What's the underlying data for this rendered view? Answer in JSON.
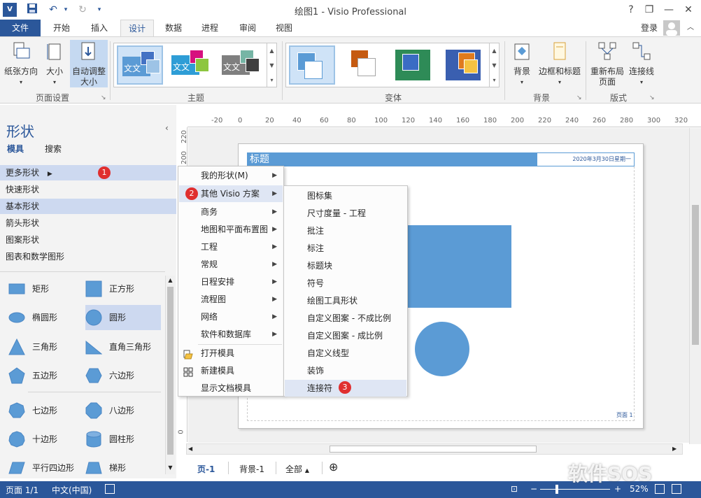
{
  "window": {
    "title": "绘图1 - Visio Professional",
    "help": "?",
    "minimize": "—",
    "restore": "❐",
    "close": "✕"
  },
  "tabs": [
    {
      "label": "文件"
    },
    {
      "label": "开始"
    },
    {
      "label": "插入"
    },
    {
      "label": "设计"
    },
    {
      "label": "数据"
    },
    {
      "label": "进程"
    },
    {
      "label": "审阅"
    },
    {
      "label": "视图"
    }
  ],
  "account": {
    "signin": "登录"
  },
  "ribbon": {
    "orientation": "纸张方向",
    "size": "大小",
    "autofit_l1": "自动调整",
    "autofit_l2": "大小",
    "page_setup": "页面设置",
    "themes": "主题",
    "variants": "变体",
    "theme_text": "文文",
    "background": "背景",
    "borders": "边框和标题",
    "bg_group": "背景",
    "relayout_l1": "重新布局",
    "relayout_l2": "页面",
    "connectors": "连接线",
    "layout_group": "版式"
  },
  "shapes_panel": {
    "title": "形状",
    "tab_stencils": "模具",
    "tab_search": "搜索",
    "categories": [
      "更多形状",
      "快速形状",
      "基本形状",
      "箭头形状",
      "图案形状",
      "图表和数学图形"
    ],
    "items": [
      "矩形",
      "正方形",
      "椭圆形",
      "圆形",
      "三角形",
      "直角三角形",
      "五边形",
      "六边形",
      "七边形",
      "八边形",
      "十边形",
      "圆柱形",
      "平行四边形",
      "梯形"
    ]
  },
  "menu1": {
    "items": [
      "我的形状(M)",
      "其他 Visio 方案",
      "商务",
      "地图和平面布置图",
      "工程",
      "常规",
      "日程安排",
      "流程图",
      "网络",
      "软件和数据库",
      "打开模具",
      "新建模具",
      "显示文档模具"
    ]
  },
  "menu2": {
    "items": [
      "图标集",
      "尺寸度量 - 工程",
      "批注",
      "标注",
      "标题块",
      "符号",
      "绘图工具形状",
      "自定义图案 - 不成比例",
      "自定义图案 - 成比例",
      "自定义线型",
      "装饰",
      "连接符"
    ]
  },
  "badges": [
    "1",
    "2",
    "3"
  ],
  "ruler_h": [
    "-20",
    "0",
    "20",
    "40",
    "60",
    "80",
    "100",
    "120",
    "140",
    "160",
    "180",
    "200",
    "220",
    "240",
    "260",
    "280",
    "300",
    "320"
  ],
  "ruler_v": [
    "220",
    "200",
    "0"
  ],
  "page": {
    "title": "标题",
    "date": "2020年3月30日星期一",
    "pagenum": "页面 1"
  },
  "page_tabs": {
    "page1": "页-1",
    "bg1": "背景-1",
    "all": "全部",
    "all_arrow": "▲",
    "add": "⊕"
  },
  "status": {
    "page": "页面 1/1",
    "lang": "中文(中国)",
    "zoom": "52%"
  },
  "watermark": "软件SOS",
  "colors": {
    "accent": "#2b579a",
    "shape_fill": "#5b9bd5",
    "badge": "#e02f2f",
    "highlight": "#cdd9f0"
  }
}
